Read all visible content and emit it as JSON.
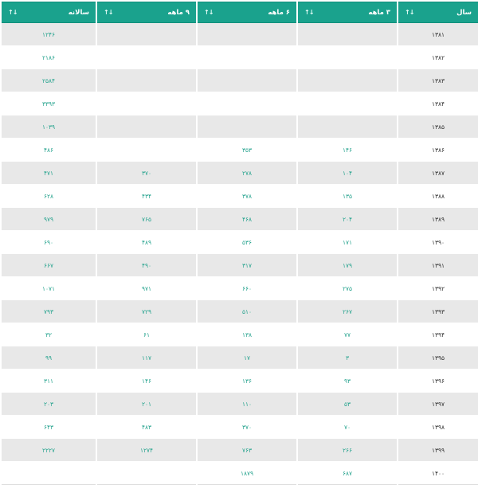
{
  "table": {
    "headers": {
      "year": "سال",
      "m3": "۳ ماهه",
      "m6": "۶ ماهه",
      "m9": "۹ ماهه",
      "annual": "سالانه",
      "sort_icon": "↓↑"
    },
    "rows": [
      {
        "year": "۱۳۸۱",
        "m3": "",
        "m6": "",
        "m9": "",
        "annual": "۱۲۴۶"
      },
      {
        "year": "۱۳۸۲",
        "m3": "",
        "m6": "",
        "m9": "",
        "annual": "۲۱۸۶"
      },
      {
        "year": "۱۳۸۳",
        "m3": "",
        "m6": "",
        "m9": "",
        "annual": "۲۵۸۴"
      },
      {
        "year": "۱۳۸۴",
        "m3": "",
        "m6": "",
        "m9": "",
        "annual": "۳۳۹۳"
      },
      {
        "year": "۱۳۸۵",
        "m3": "",
        "m6": "",
        "m9": "",
        "annual": "۱۰۳۹"
      },
      {
        "year": "۱۳۸۶",
        "m3": "۱۴۶",
        "m6": "۳۵۳",
        "m9": "",
        "annual": "۴۸۶"
      },
      {
        "year": "۱۳۸۷",
        "m3": "۱۰۴",
        "m6": "۲۷۸",
        "m9": "۳۷۰",
        "annual": "۴۷۱"
      },
      {
        "year": "۱۳۸۸",
        "m3": "۱۳۵",
        "m6": "۳۷۸",
        "m9": "۴۳۴",
        "annual": "۶۲۸"
      },
      {
        "year": "۱۳۸۹",
        "m3": "۲۰۴",
        "m6": "۴۶۸",
        "m9": "۷۶۵",
        "annual": "۹۷۹"
      },
      {
        "year": "۱۳۹۰",
        "m3": "۱۷۱",
        "m6": "۵۳۶",
        "m9": "۴۸۹",
        "annual": "۶۹۰"
      },
      {
        "year": "۱۳۹۱",
        "m3": "۱۷۹",
        "m6": "۳۱۷",
        "m9": "۴۹۰",
        "annual": "۶۶۷"
      },
      {
        "year": "۱۳۹۲",
        "m3": "۲۷۵",
        "m6": "۶۶۰",
        "m9": "۹۷۱",
        "annual": "۱۰۷۱"
      },
      {
        "year": "۱۳۹۳",
        "m3": "۲۶۷",
        "m6": "۵۱۰",
        "m9": "۷۲۹",
        "annual": "۷۹۳"
      },
      {
        "year": "۱۳۹۴",
        "m3": "۷۷",
        "m6": "۱۳۸",
        "m9": "۶۱",
        "annual": "۳۲"
      },
      {
        "year": "۱۳۹۵",
        "m3": "۳",
        "m6": "۱۷",
        "m9": "۱۱۷",
        "annual": "۹۹"
      },
      {
        "year": "۱۳۹۶",
        "m3": "۹۳",
        "m6": "۱۳۶",
        "m9": "۱۴۶",
        "annual": "۳۱۱"
      },
      {
        "year": "۱۳۹۷",
        "m3": "۵۳",
        "m6": "۱۱۰",
        "m9": "۲۰۱",
        "annual": "۲۰۳"
      },
      {
        "year": "۱۳۹۸",
        "m3": "۷۰",
        "m6": "۳۷۰",
        "m9": "۴۸۳",
        "annual": "۶۴۳"
      },
      {
        "year": "۱۳۹۹",
        "m3": "۲۶۶",
        "m6": "۷۶۳",
        "m9": "۱۲۷۴",
        "annual": "۲۲۲۷"
      },
      {
        "year": "۱۴۰۰",
        "m3": "۶۸۷",
        "m6": "۱۸۷۹",
        "m9": "",
        "annual": ""
      }
    ]
  }
}
